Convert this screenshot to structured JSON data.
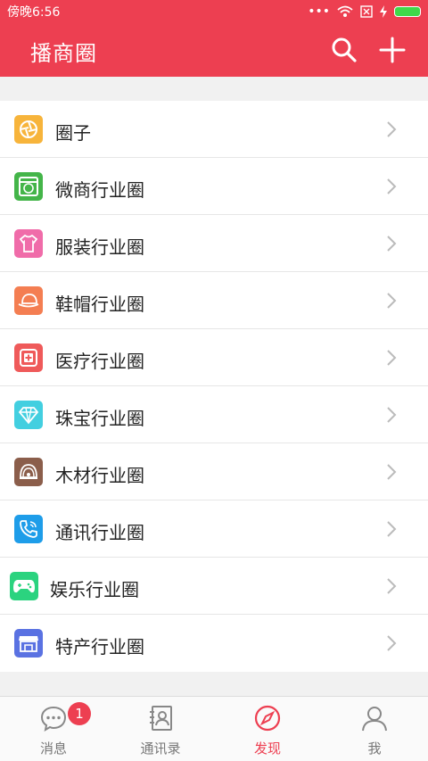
{
  "status": {
    "time": "傍晚6:56",
    "signal_dots": "•••"
  },
  "header": {
    "title": "播商圈"
  },
  "colors": {
    "brand": "#ed3f51",
    "background": "#f1f1f1"
  },
  "list": [
    {
      "label": "圈子",
      "icon": "aperture-icon",
      "color": "#f7b43b"
    },
    {
      "label": "微商行业圈",
      "icon": "wechat-store-icon",
      "color": "#44b549"
    },
    {
      "label": "服装行业圈",
      "icon": "shirt-icon",
      "color": "#f06ca9"
    },
    {
      "label": "鞋帽行业圈",
      "icon": "hat-icon",
      "color": "#f47e52"
    },
    {
      "label": "医疗行业圈",
      "icon": "medical-kit-icon",
      "color": "#ef5a5a"
    },
    {
      "label": "珠宝行业圈",
      "icon": "diamond-icon",
      "color": "#43cfe0"
    },
    {
      "label": "木材行业圈",
      "icon": "wood-icon",
      "color": "#8b5e4b"
    },
    {
      "label": "通讯行业圈",
      "icon": "phone-icon",
      "color": "#1e9de9"
    },
    {
      "label": "娱乐行业圈",
      "icon": "gamepad-icon",
      "color": "#2bd37f"
    },
    {
      "label": "特产行业圈",
      "icon": "shop-icon",
      "color": "#5a72e2"
    }
  ],
  "tabs": [
    {
      "label": "消息",
      "badge": "1"
    },
    {
      "label": "通讯录"
    },
    {
      "label": "发现"
    },
    {
      "label": "我"
    }
  ]
}
